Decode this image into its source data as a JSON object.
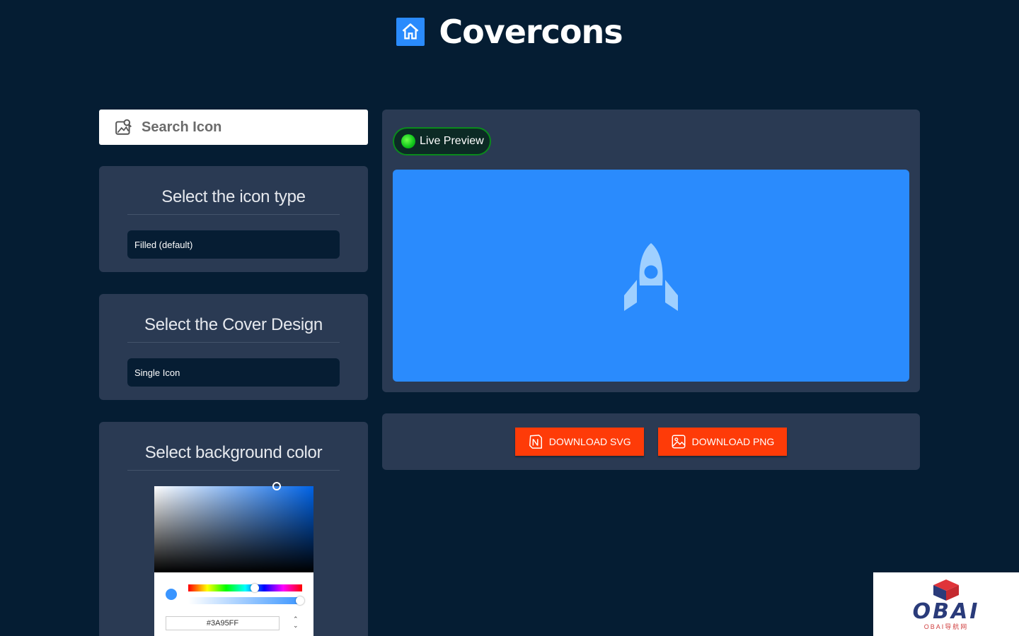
{
  "header": {
    "brand": "Covercons",
    "logo_icon": "home-icon"
  },
  "search": {
    "label": "Search Icon",
    "icon": "image-search-icon"
  },
  "icon_type_panel": {
    "title": "Select the icon type",
    "selected": "Filled (default)"
  },
  "cover_design_panel": {
    "title": "Select the Cover Design",
    "selected": "Single Icon"
  },
  "bg_color_panel": {
    "title": "Select background color",
    "hex_value": "#3A95FF",
    "hue_level": 0.59,
    "alpha_level": 1.0
  },
  "preview": {
    "badge_label": "Live Preview",
    "cover_color": "#2a8bfd",
    "icon": "rocket-icon"
  },
  "downloads": {
    "svg_label": "DOWNLOAD SVG",
    "svg_icon": "notion-icon",
    "png_label": "DOWNLOAD PNG",
    "png_icon": "image-icon"
  },
  "watermark": {
    "text": "OBAI",
    "sub": "OBAI导航网"
  },
  "colors": {
    "background": "#051d33",
    "panel": "#2a3a53",
    "accent": "#2a8bfd",
    "download": "#fe3b08"
  }
}
